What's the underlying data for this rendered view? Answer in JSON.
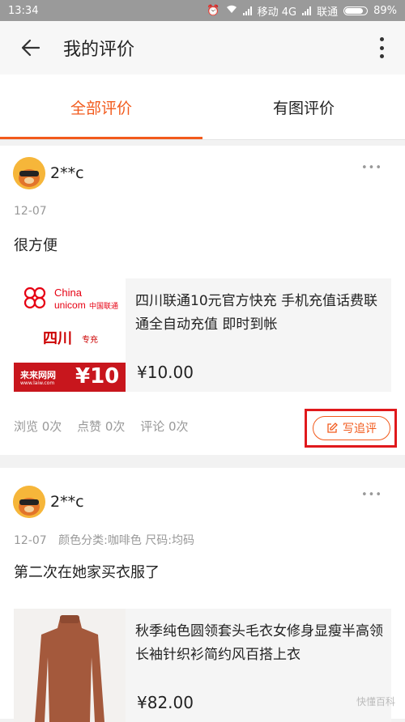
{
  "status_bar": {
    "time": "13:34",
    "carrier1": "移动 4G",
    "carrier2": "联通",
    "battery": "89%"
  },
  "header": {
    "title": "我的评价"
  },
  "tabs": [
    {
      "label": "全部评价",
      "active": true
    },
    {
      "label": "有图评价",
      "active": false
    }
  ],
  "reviews": [
    {
      "user": "2**c",
      "date": "12-07",
      "spec": "",
      "content": "很方便",
      "product": {
        "title": "四川联通10元官方快充 手机充值话费联通全自动充值 即时到帐",
        "price": "¥10.00",
        "thumb": {
          "brand_en1": "China",
          "brand_en2": "unicom",
          "brand_cn": "中国联通",
          "region": "四川",
          "tag": "专充",
          "shop": "来来网网",
          "shop_url": "www.laiw.com",
          "face_value": "¥10"
        }
      },
      "stats": {
        "views": "浏览 0次",
        "likes": "点赞 0次",
        "comments": "评论 0次"
      },
      "append_label": "写追评"
    },
    {
      "user": "2**c",
      "date": "12-07",
      "spec": "颜色分类:咖啡色 尺码:均码",
      "content": "第二次在她家买衣服了",
      "product": {
        "title": "秋季纯色圆领套头毛衣女修身显瘦半高领长袖针织衫简约风百搭上衣",
        "price": "¥82.00"
      }
    }
  ],
  "watermark": "快懂百科",
  "colors": {
    "accent": "#f25a1c",
    "highlight": "#e0191c"
  }
}
